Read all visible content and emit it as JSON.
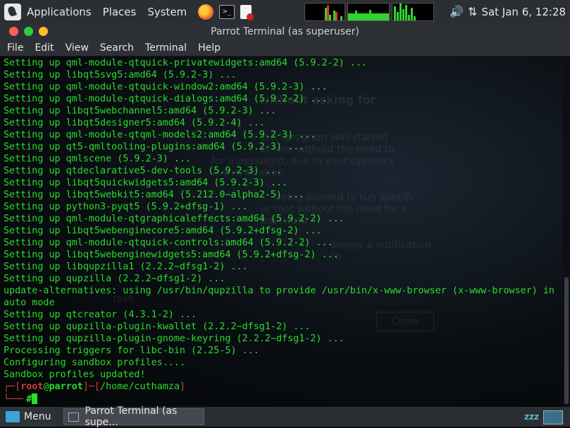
{
  "top_panel": {
    "menus": [
      "Applications",
      "Places",
      "System"
    ],
    "clock": "Sat Jan  6, 12:28"
  },
  "window": {
    "title": "Parrot Terminal (as superuser)",
    "menu": [
      "File",
      "Edit",
      "View",
      "Search",
      "Terminal",
      "Help"
    ]
  },
  "terminal": {
    "lines": [
      "Setting up qml-module-qtquick-privatewidgets:amd64 (5.9.2-2) ...",
      "Setting up libqt5svg5:amd64 (5.9.2-3) ...",
      "Setting up qml-module-qtquick-window2:amd64 (5.9.2-3) ...",
      "Setting up qml-module-qtquick-dialogs:amd64 (5.9.2-2) ...",
      "Setting up libqt5webchannel5:amd64 (5.9.2-3) ...",
      "Setting up libqt5designer5:amd64 (5.9.2-4) ...",
      "Setting up qml-module-qtqml-models2:amd64 (5.9.2-3) ...",
      "Setting up qt5-qmltooling-plugins:amd64 (5.9.2-3) ...",
      "Setting up qmlscene (5.9.2-3) ...",
      "Setting up qtdeclarative5-dev-tools (5.9.2-3) ...",
      "Setting up libqt5quickwidgets5:amd64 (5.9.2-3) ...",
      "Setting up libqt5webkit5:amd64 (5.212.0~alpha2-5) ...",
      "Setting up python3-pyqt5 (5.9.2+dfsg-1) ...",
      "Setting up qml-module-qtgraphicaleffects:amd64 (5.9.2-2) ...",
      "Setting up libqt5webenginecore5:amd64 (5.9.2+dfsg-2) ...",
      "Setting up qml-module-qtquick-controls:amd64 (5.9.2-2) ...",
      "Setting up libqt5webenginewidgets5:amd64 (5.9.2+dfsg-2) ...",
      "Setting up libqupzilla1 (2.2.2~dfsg1-2) ...",
      "Setting up qupzilla (2.2.2~dfsg1-2) ...",
      "update-alternatives: using /usr/bin/qupzilla to provide /usr/bin/x-www-browser (x-www-browser) in",
      "auto mode",
      "Setting up qtcreator (4.3.1-2) ...",
      "Setting up qupzilla-plugin-kwallet (2.2.2~dfsg1-2) ...",
      "Setting up qupzilla-plugin-gnome-keyring (2.2.2~dfsg1-2) ...",
      "Processing triggers for libc-bin (2.25-5) ...",
      "Configuring sandbox profiles....",
      "Sandbox profiles updated!"
    ],
    "prompt": {
      "open": "┌─[",
      "user": "root",
      "at": "@",
      "host": "parrot",
      "mid": "]─[",
      "path": "/home/cuthamza",
      "close": "]",
      "corner": "└──╴",
      "symbol": "#"
    },
    "background_dialog": {
      "heading": "without asking for",
      "text_lines": [
        "ator' program was started",
        "ot user without the need to",
        "for a password, due to your system's authentication",
        "being allowed to run specific",
        "er root without the need for a password,",
        "simply a notification to",
        "rash"
      ],
      "close_label": "Close"
    }
  },
  "taskbar": {
    "menu_label": "Menu",
    "task_label": "Parrot Terminal (as supe...",
    "sleep_label": "zzz"
  },
  "colors": {
    "terminal_text": "#2bdc2b",
    "prompt_red": "#d23a3a",
    "panel": "#2b2e33"
  }
}
